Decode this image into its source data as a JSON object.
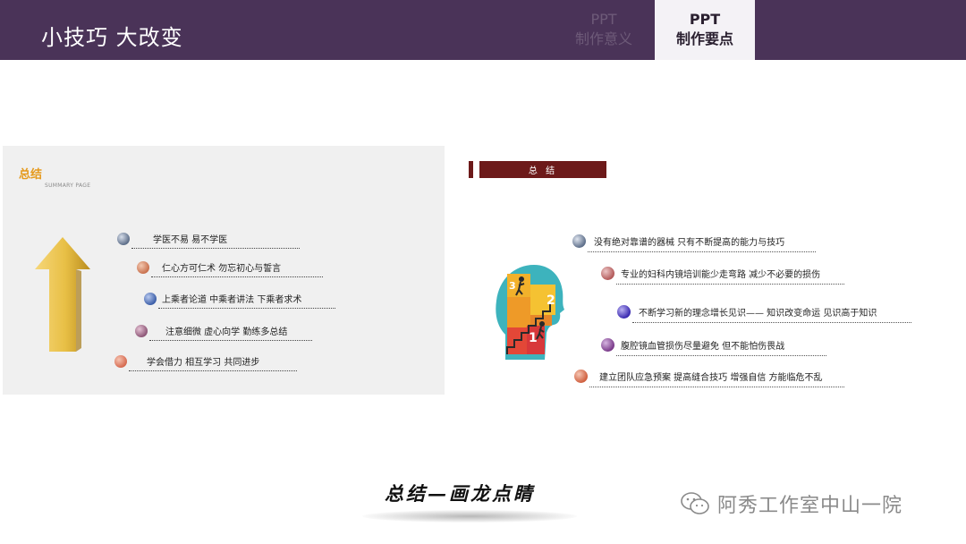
{
  "header": {
    "title": "小技巧  大改变",
    "tabs": [
      {
        "line1": "PPT",
        "line2": "制作意义",
        "active": false
      },
      {
        "line1": "PPT",
        "line2": "制作要点",
        "active": true
      }
    ]
  },
  "left_slide": {
    "title": "总结",
    "subtitle": "SUMMARY PAGE",
    "items": [
      {
        "text": "学医不易   易不学医",
        "color": "#5e6f8a"
      },
      {
        "text": "仁心方可仁术   勿忘初心与誓言",
        "color": "#c9724f"
      },
      {
        "text": "上乘者论道   中乘者讲法   下乘者求术",
        "color": "#3d5fa8"
      },
      {
        "text": "注意细微  虚心向学  勤练多总结",
        "color": "#8e5878"
      },
      {
        "text": "学会借力  相互学习   共同进步",
        "color": "#d66a50"
      }
    ]
  },
  "right_slide": {
    "bar_title": "总 结",
    "steps": [
      "3",
      "2",
      "1"
    ],
    "items": [
      {
        "text": "没有绝对靠谱的器械  只有不断提高的能力与技巧",
        "color": "#5e6f8a"
      },
      {
        "text": "专业的妇科内镜培训能少走弯路    减少不必要的损伤",
        "color": "#b35a5a"
      },
      {
        "text": "不断学习新的理念增长见识——  知识改变命运   见识高于知识",
        "color": "#3a2ab0"
      },
      {
        "text": "腹腔镜血管损伤尽量避免    但不能怕伤畏战",
        "color": "#7a3a8a"
      },
      {
        "text": "建立团队应急预案   提高缝合技巧   增强自信   方能临危不乱",
        "color": "#d0603f"
      }
    ]
  },
  "bottom": {
    "caption": "总结—画龙点睛",
    "watermark": "阿秀工作室中山一院",
    "watermark_icon": "wechat-icon"
  }
}
